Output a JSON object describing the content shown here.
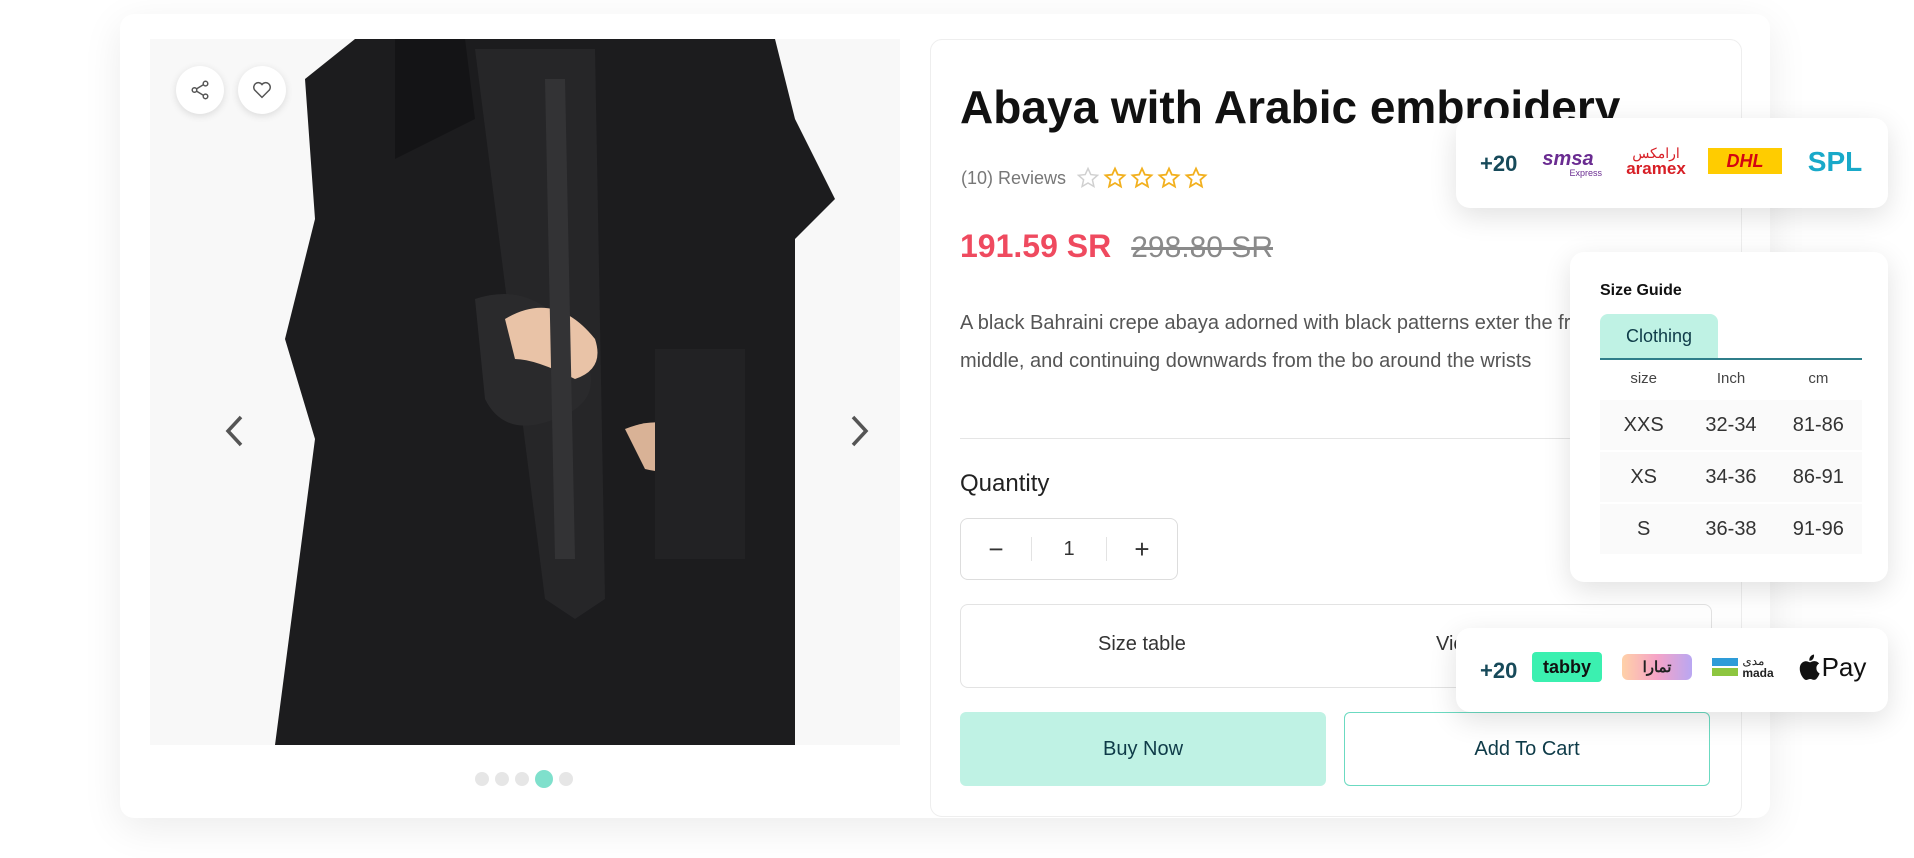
{
  "product": {
    "title": "Abaya with Arabic embroidery",
    "reviews_label": "(10) Reviews",
    "rating": 4,
    "rating_max": 5,
    "price_now": "191.59 SR",
    "price_old": "298.80 SR",
    "description": "A black Bahraini crepe abaya adorned with black patterns exter the front to the middle, and continuing downwards from the bo around the wrists",
    "quantity_label": "Quantity",
    "quantity_value": "1",
    "minus_label": "−",
    "plus_label": "+",
    "tab_size_table": "Size table",
    "tab_view": "Vie",
    "buy_now_label": "Buy Now",
    "add_to_cart_label": "Add To Cart"
  },
  "gallery": {
    "slide_count": 5,
    "active_slide": 4
  },
  "shipping": {
    "more_label": "+20",
    "logos": [
      "smsa",
      "aramex",
      "DHL",
      "SPL"
    ],
    "smsa_text": "smsa",
    "smsa_sub": "Express",
    "aramex_ar": "ارامكس",
    "aramex_text": "aramex",
    "dhl_text": "DHL",
    "spl_text": "SPL"
  },
  "payments": {
    "more_label": "+20",
    "tabby_text": "tabby",
    "tamara_text": "تمارا",
    "mada_ar": "مدى",
    "mada_text": "mada",
    "applepay_text": "Pay"
  },
  "size_guide": {
    "title": "Size Guide",
    "tab": "Clothing",
    "headers": [
      "size",
      "Inch",
      "cm"
    ],
    "rows": [
      [
        "XXS",
        "32-34",
        "81-86"
      ],
      [
        "XS",
        "34-36",
        "86-91"
      ],
      [
        "S",
        "36-38",
        "91-96"
      ]
    ]
  },
  "colors": {
    "accent": "#7fe0cc",
    "price": "#ef4a5f",
    "buy_bg": "#bff2e4",
    "dark_text": "#0e3b48"
  }
}
